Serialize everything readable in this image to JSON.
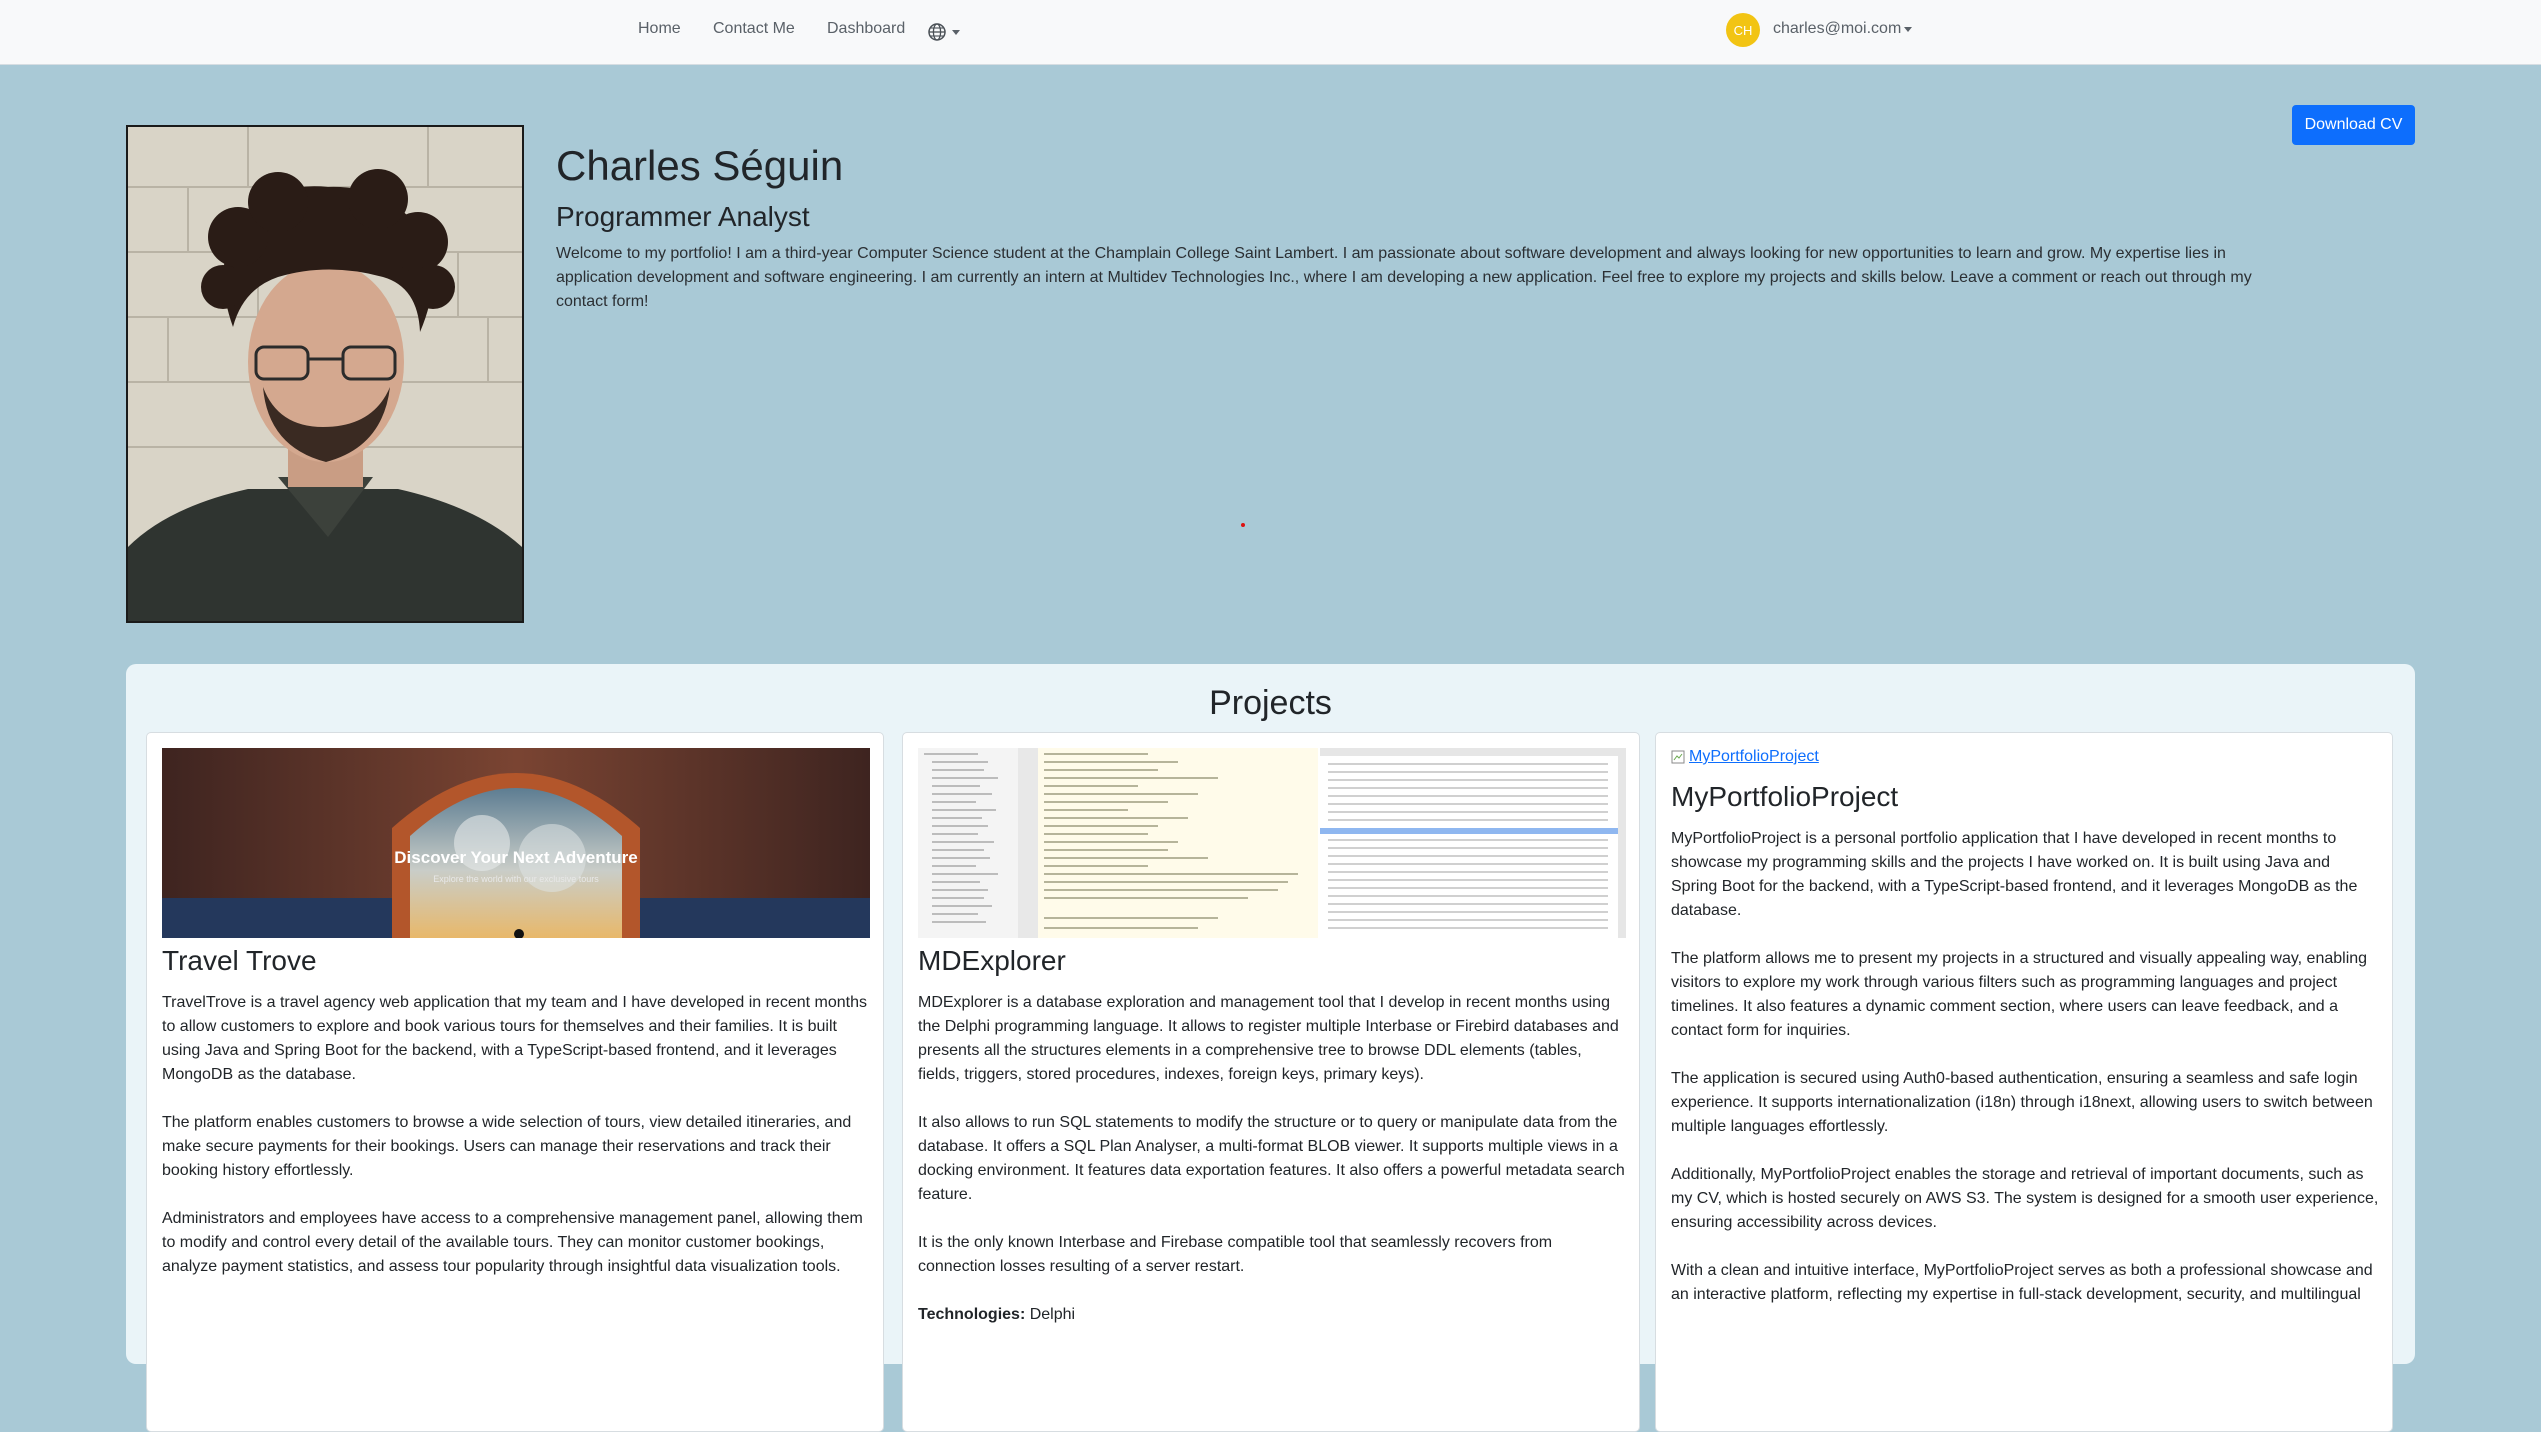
{
  "nav": {
    "links": [
      "Home",
      "Contact Me",
      "Dashboard"
    ],
    "avatar_initials": "CH",
    "user_email": "charles@moi.com"
  },
  "profile": {
    "download_label": "Download CV",
    "name": "Charles Séguin",
    "role": "Programmer Analyst",
    "bio": "Welcome to my portfolio! I am a third-year Computer Science student at the Champlain College Saint Lambert. I am passionate about software development and always looking for new opportunities to learn and grow. My expertise lies in application development and software engineering. I am currently an intern at Multidev Technologies Inc., where I am developing a new application. Feel free to explore my projects and skills below. Leave a comment or reach out through my contact form!"
  },
  "projects": {
    "title": "Projects",
    "cards": [
      {
        "title": "Travel Trove",
        "hero_title": "Discover Your Next Adventure",
        "hero_subtitle": "Explore the world with our exclusive tours",
        "paragraphs": [
          "TravelTrove is a travel agency web application that my team and I have developed in recent months to allow customers to explore and book various tours for themselves and their families. It is built using Java and Spring Boot for the backend, with a TypeScript-based frontend, and it leverages MongoDB as the database.",
          "The platform enables customers to browse a wide selection of tours, view detailed itineraries, and make secure payments for their bookings. Users can manage their reservations and track their booking history effortlessly.",
          "Administrators and employees have access to a comprehensive management panel, allowing them to modify and control every detail of the available tours. They can monitor customer bookings, analyze payment statistics, and assess tour popularity through insightful data visualization tools."
        ]
      },
      {
        "title": "MDExplorer",
        "paragraphs": [
          "MDExplorer is a database exploration and management tool that I develop in recent months using the Delphi programming language. It allows to register multiple Interbase or Firebird databases and presents all the structures elements in a comprehensive tree to browse DDL elements (tables, fields, triggers, stored procedures, indexes, foreign keys, primary keys).",
          "It also allows to run SQL statements to modify the structure or to query or manipulate data from the database. It offers a SQL Plan Analyser, a multi-format BLOB viewer. It supports multiple views in a docking environment. It features data exportation features. It also offers a powerful metadata search feature.",
          "It is the only known Interbase and Firebase compatible tool that seamlessly recovers from connection losses resulting of a server restart."
        ],
        "tech_label": "Technologies:",
        "tech_value": " Delphi"
      },
      {
        "title": "MyPortfolioProject",
        "image_alt": "MyPortfolioProject",
        "paragraphs": [
          "MyPortfolioProject is a personal portfolio application that I have developed in recent months to showcase my programming skills and the projects I have worked on. It is built using Java and Spring Boot for the backend, with a TypeScript-based frontend, and it leverages MongoDB as  the database.",
          "The platform allows me to present my projects in a structured and visually appealing way,  enabling visitors to explore my work through various filters such as programming languages  and project timelines. It also features a dynamic comment section, where users can leave  feedback, and a contact form for inquiries.",
          "The application is secured using Auth0-based authentication, ensuring a seamless and safe  login experience. It supports internationalization (i18n) through i18next, allowing users to  switch between multiple languages effortlessly.",
          "Additionally, MyPortfolioProject enables the storage and retrieval of important documents, such  as my CV, which is hosted securely on AWS S3. The system is designed for a smooth user experience, ensuring accessibility across devices.",
          "With a clean and intuitive interface, MyPortfolioProject serves as both a professional showcase  and an interactive platform, reflecting my expertise in full-stack development, security, and  multilingual"
        ]
      }
    ]
  }
}
